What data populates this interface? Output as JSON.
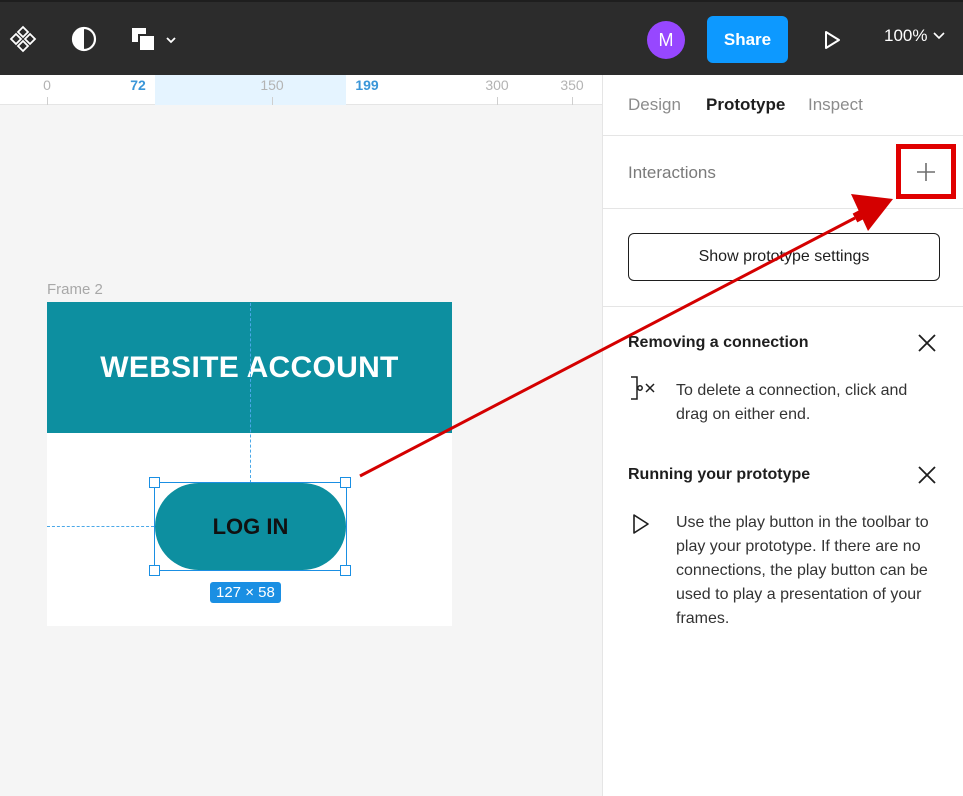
{
  "toolbar": {
    "avatar_initial": "M",
    "share_label": "Share",
    "zoom_label": "100%"
  },
  "ruler": {
    "ticks": [
      "0",
      "72",
      "150",
      "199",
      "300",
      "350"
    ]
  },
  "canvas": {
    "frame_label": "Frame 2",
    "header_text": "WEBSITE ACCOUNT",
    "button_text": "LOG IN",
    "dimensions": "127 × 58"
  },
  "panel": {
    "tabs": [
      "Design",
      "Prototype",
      "Inspect"
    ],
    "interactions_label": "Interactions",
    "settings_button": "Show prototype settings",
    "help": [
      {
        "title": "Removing a connection",
        "text": "To delete a connection, click and drag on either end."
      },
      {
        "title": "Running your prototype",
        "text": "Use the play button in the toolbar to play your prototype. If there are no connections, the play button can be used to play a presentation of your frames."
      }
    ]
  },
  "colors": {
    "accent": "#0d99ff",
    "frame_teal": "#0d8fa0",
    "highlight_red": "#e00000",
    "avatar_purple": "#9747ff"
  }
}
